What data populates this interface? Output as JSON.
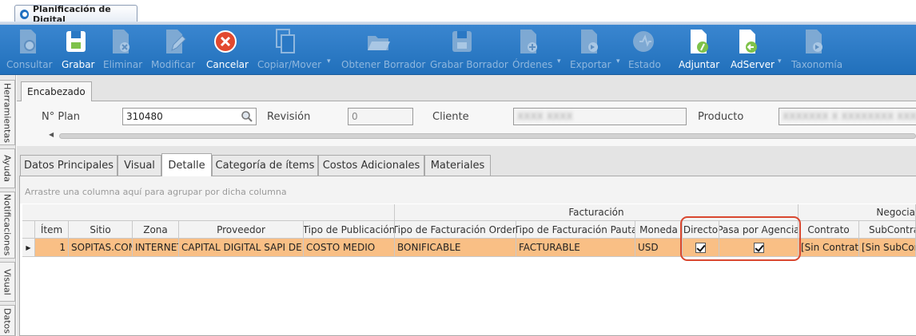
{
  "window": {
    "title": "Planificación de Digital"
  },
  "toolbar": {
    "buttons": [
      {
        "label": "Consultar",
        "icon": "document-search-icon",
        "enabled": false
      },
      {
        "label": "Grabar",
        "icon": "floppy-save-icon",
        "enabled": true
      },
      {
        "label": "Eliminar",
        "icon": "document-delete-icon",
        "enabled": false
      },
      {
        "label": "Modificar",
        "icon": "document-edit-icon",
        "enabled": false
      },
      {
        "label": "Cancelar",
        "icon": "cancel-icon",
        "enabled": true
      },
      {
        "label": "Copiar/Mover",
        "icon": "copy-icon",
        "enabled": false
      },
      {
        "label": "Obtener Borrador",
        "icon": "folder-open-icon",
        "enabled": false
      },
      {
        "label": "Grabar Borrador",
        "icon": "floppy-draft-icon",
        "enabled": false
      },
      {
        "label": "Órdenes",
        "icon": "document-orders-icon",
        "enabled": false
      },
      {
        "label": "Exportar",
        "icon": "document-export-icon",
        "enabled": false
      },
      {
        "label": "Estado",
        "icon": "status-icon",
        "enabled": false
      },
      {
        "label": "Adjuntar",
        "icon": "attach-icon",
        "enabled": true
      },
      {
        "label": "AdServer",
        "icon": "adserver-icon",
        "enabled": true
      },
      {
        "label": "Taxonomía",
        "icon": "taxonomy-icon",
        "enabled": false
      }
    ]
  },
  "dock": {
    "tabs": [
      "Herramientas",
      "Ayuda",
      "Notificaciones",
      "Visual",
      "Datos"
    ]
  },
  "encabezado": {
    "tab_label": "Encabezado",
    "plan_label": "N° Plan",
    "plan_value": "310480",
    "revision_label": "Revisión",
    "revision_value": "0",
    "cliente_label": "Cliente",
    "cliente_value": "XXXX XXXX",
    "producto_label": "Producto",
    "producto_value": "XXXXXXX X XXXXXXXX XXXXX"
  },
  "detail_tabs": [
    "Datos Principales",
    "Visual",
    "Detalle",
    "Categoría de ítems",
    "Costos Adicionales",
    "Materiales"
  ],
  "active_tab": "Detalle",
  "grid": {
    "group_hint": "Arrastre una columna aquí para agrupar por dicha columna",
    "band_facturacion": "Facturación",
    "band_negociacion": "Negocia",
    "columns": [
      "Ítem",
      "Sitio",
      "Zona",
      "Proveedor",
      "Tipo de Publicación",
      "Tipo de Facturación Orden",
      "Tipo de Facturación Pauta",
      "Moneda",
      "Directo",
      "Pasa por Agencia",
      "Contrato",
      "SubContrat"
    ],
    "rows": [
      {
        "item": "1",
        "sitio": "SOPITAS.COM",
        "zona": "INTERNET",
        "proveedor": "CAPITAL DIGITAL SAPI DE CV",
        "tipo_publicacion": "COSTO MEDIO",
        "tipo_fact_orden": "BONIFICABLE",
        "tipo_fact_pauta": "FACTURABLE",
        "moneda": "USD",
        "directo": true,
        "pasa_por_agencia": true,
        "contrato": "[Sin Contrato]",
        "subcontrato": "[Sin SubContrat"
      }
    ]
  },
  "colors": {
    "toolbar": "#2a78c4",
    "row_selected": "#f9bf85",
    "highlight": "#d9472f"
  }
}
